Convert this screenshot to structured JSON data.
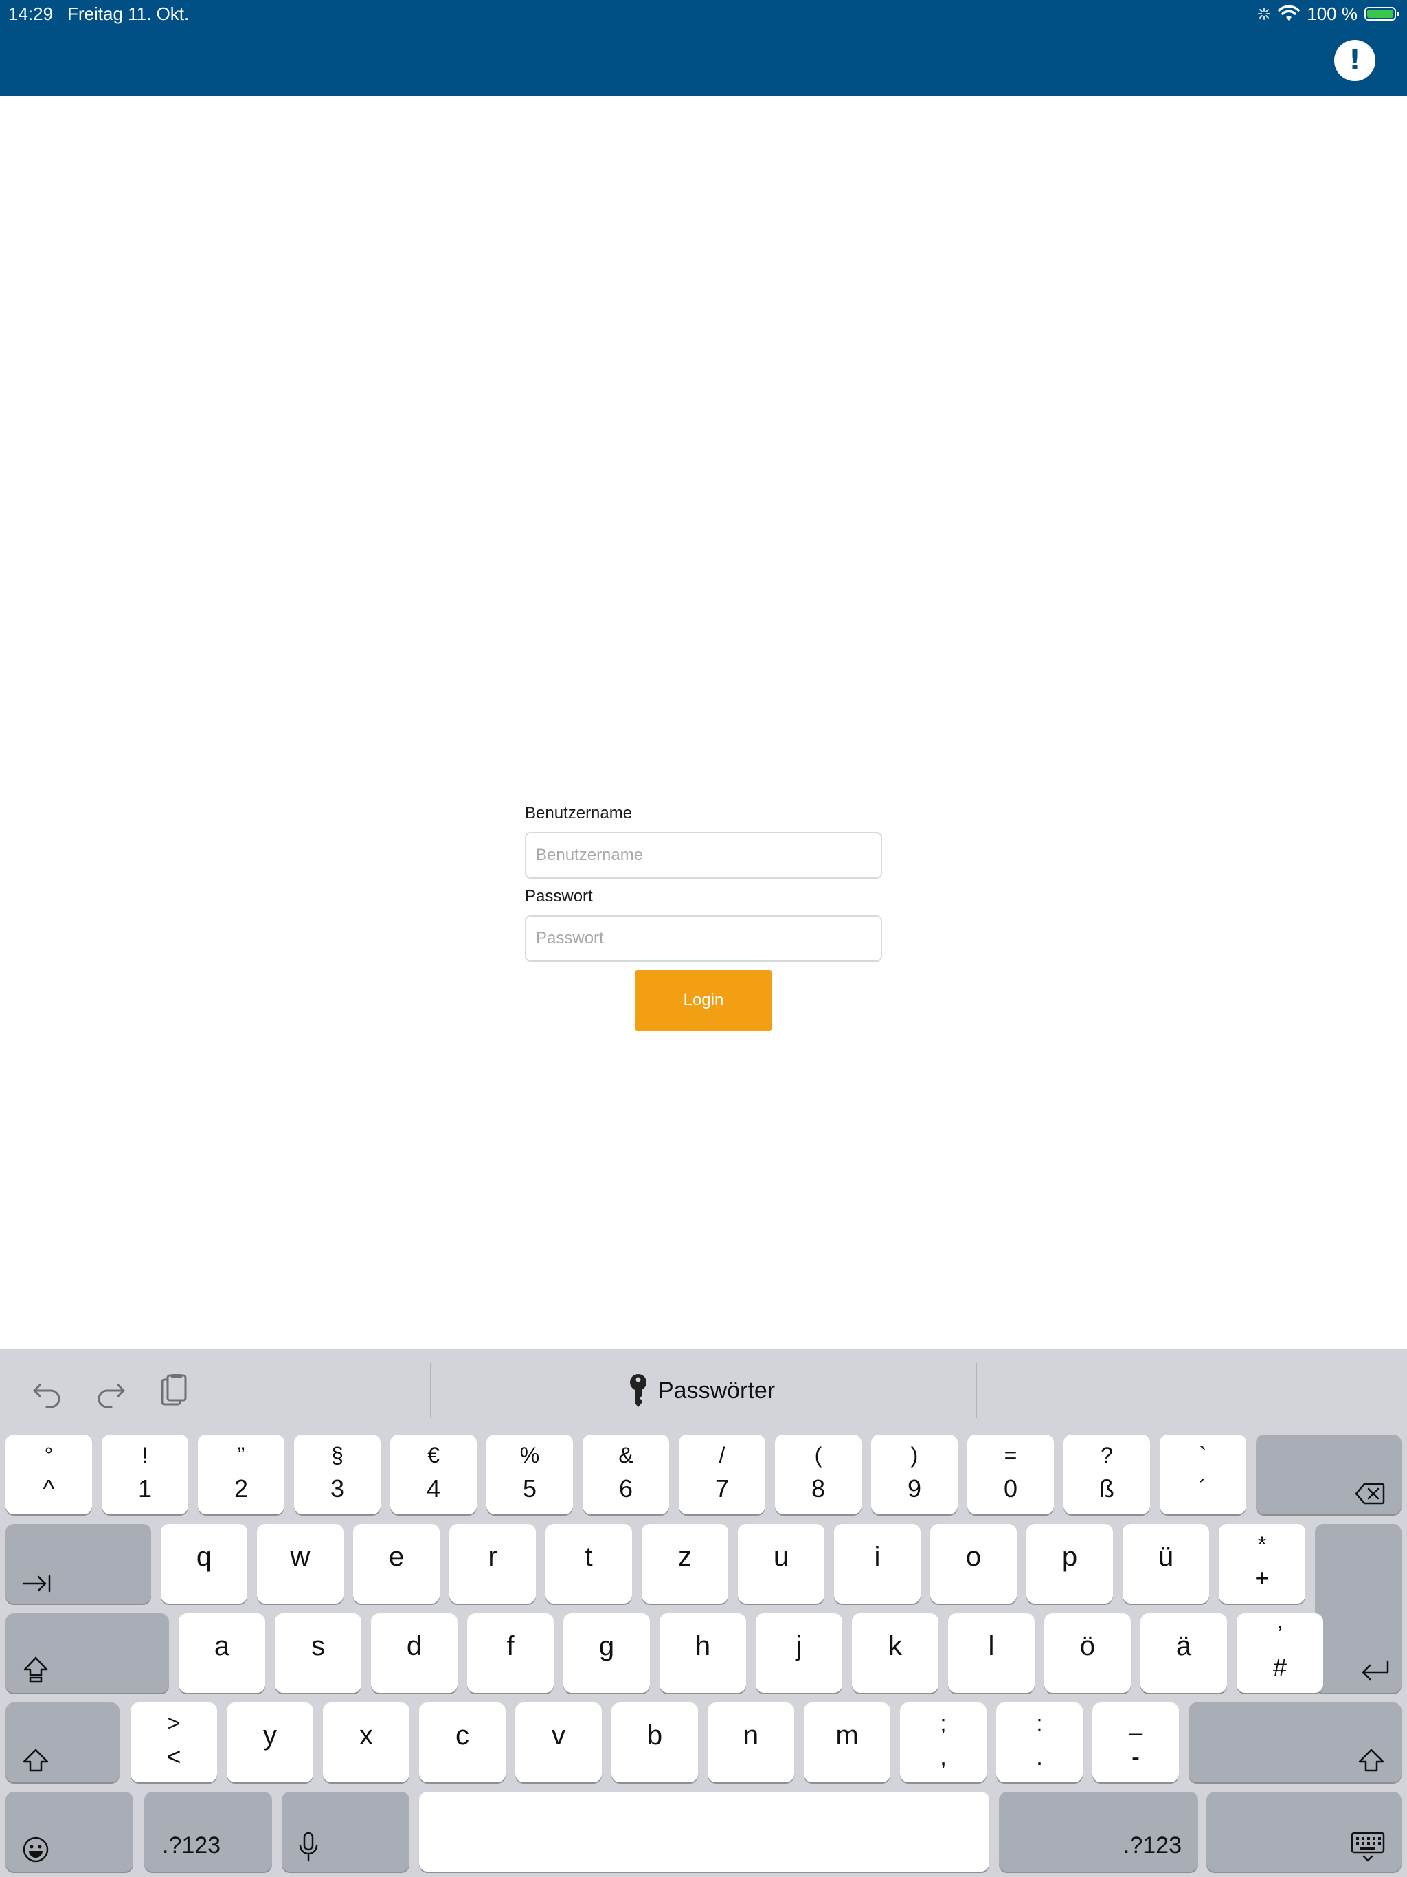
{
  "status_bar": {
    "time": "14:29",
    "date": "Freitag 11. Okt.",
    "battery": "100 %"
  },
  "header": {
    "alert_symbol": "!",
    "background_color": "#005085"
  },
  "login_form": {
    "username_label": "Benutzername",
    "username_placeholder": "Benutzername",
    "password_label": "Passwort",
    "password_placeholder": "Passwort",
    "login_button": "Login",
    "button_color": "#f29f14"
  },
  "keyboard": {
    "suggestion": "Passwörter",
    "number_row": [
      {
        "top": "°",
        "bottom": "^"
      },
      {
        "top": "!",
        "bottom": "1"
      },
      {
        "top": "”",
        "bottom": "2"
      },
      {
        "top": "§",
        "bottom": "3"
      },
      {
        "top": "€",
        "bottom": "4"
      },
      {
        "top": "%",
        "bottom": "5"
      },
      {
        "top": "&",
        "bottom": "6"
      },
      {
        "top": "/",
        "bottom": "7"
      },
      {
        "top": "(",
        "bottom": "8"
      },
      {
        "top": ")",
        "bottom": "9"
      },
      {
        "top": "=",
        "bottom": "0"
      },
      {
        "top": "?",
        "bottom": "ß"
      },
      {
        "top": "`",
        "bottom": "´"
      }
    ],
    "row_q": [
      "q",
      "w",
      "e",
      "r",
      "t",
      "z",
      "u",
      "i",
      "o",
      "p",
      "ü"
    ],
    "row_q_last": {
      "top": "*",
      "bottom": "+"
    },
    "row_a": [
      "a",
      "s",
      "d",
      "f",
      "g",
      "h",
      "j",
      "k",
      "l",
      "ö",
      "ä"
    ],
    "row_a_last": {
      "top": "’",
      "bottom": "#"
    },
    "row_y_first": {
      "top": ">",
      "bottom": "<"
    },
    "row_y": [
      "y",
      "x",
      "c",
      "v",
      "b",
      "n",
      "m"
    ],
    "row_y_tail": [
      {
        "top": ";",
        "bottom": ","
      },
      {
        "top": ":",
        "bottom": "."
      },
      {
        "top": "_",
        "bottom": "-"
      }
    ],
    "numbers_label": ".?123"
  }
}
